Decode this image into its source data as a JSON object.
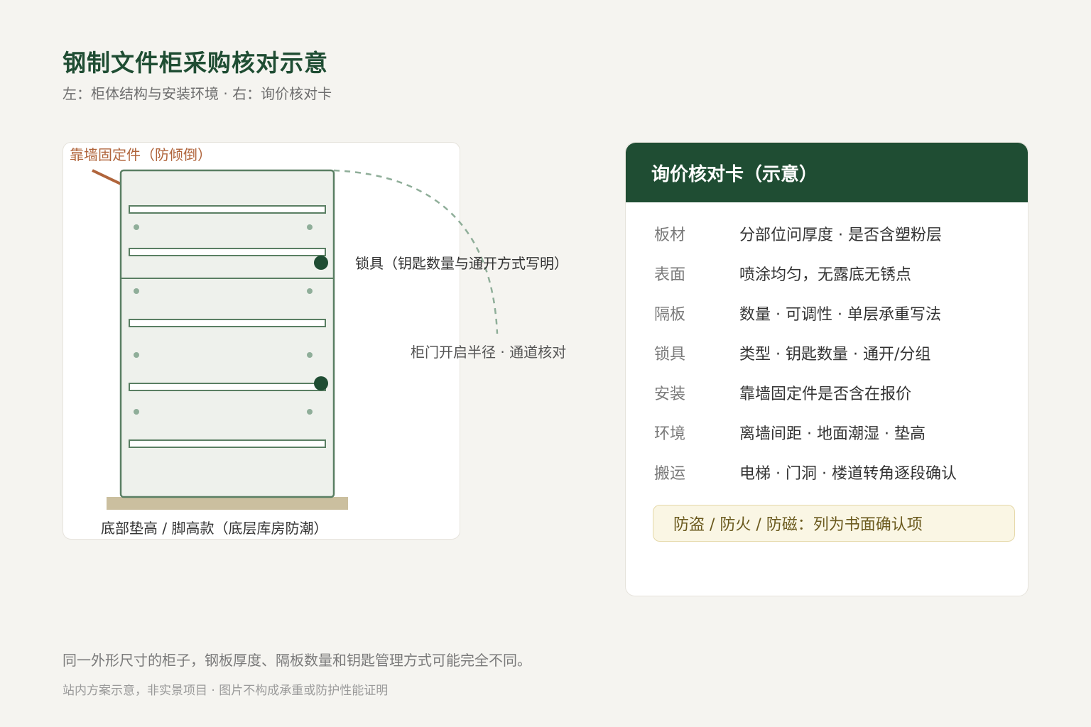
{
  "header": {
    "title": "钢制文件柜采购核对示意",
    "subtitle": "左：柜体结构与安装环境 · 右：询价核对卡"
  },
  "diagram": {
    "anchor_label": "靠墙固定件（防倾倒）",
    "lock_label": "锁具（钥匙数量与通开方式写明）",
    "door_label": "柜门开启半径 · 通道核对",
    "base_label": "底部垫高 / 脚高款（底层库房防潮）"
  },
  "card": {
    "title": "询价核对卡（示意）",
    "rows": [
      {
        "key": "板材",
        "value": "分部位问厚度 · 是否含塑粉层"
      },
      {
        "key": "表面",
        "value": "喷涂均匀，无露底无锈点"
      },
      {
        "key": "隔板",
        "value": "数量 · 可调性 · 单层承重写法"
      },
      {
        "key": "锁具",
        "value": "类型 · 钥匙数量 · 通开/分组"
      },
      {
        "key": "安装",
        "value": "靠墙固定件是否含在报价"
      },
      {
        "key": "环境",
        "value": "离墙间距 · 地面潮湿 · 垫高"
      },
      {
        "key": "搬运",
        "value": "电梯 · 门洞 · 楼道转角逐段确认"
      }
    ],
    "note": "防盗 / 防火 / 防磁：列为书面确认项"
  },
  "footer": {
    "line1": "同一外形尺寸的柜子，钢板厚度、隔板数量和钥匙管理方式可能完全不同。",
    "line2": "站内方案示意，非实景项目 · 图片不构成承重或防护性能证明"
  },
  "colors": {
    "brand_green": "#1f4d33",
    "cabinet_stroke": "#5a7f63",
    "cabinet_fill": "#eef1ec",
    "anchor_brown": "#b0643b",
    "base_tan": "#cbbf9f",
    "dashed_arc": "#8fae99",
    "note_bg": "#faf6e4"
  }
}
